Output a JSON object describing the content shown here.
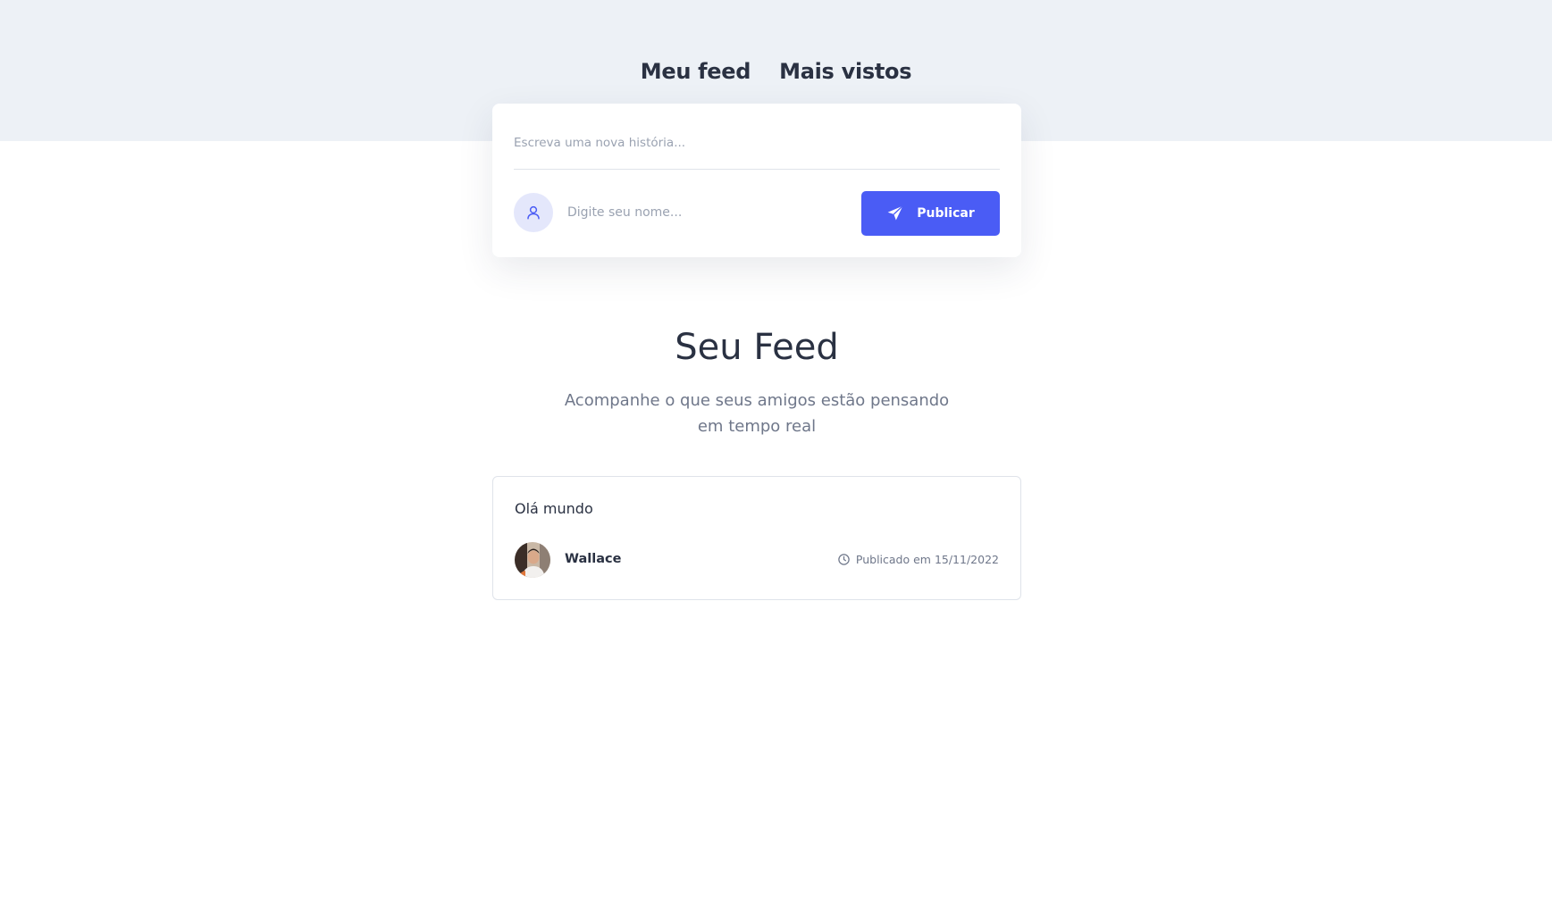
{
  "nav": {
    "tabs": [
      {
        "label": "Meu feed"
      },
      {
        "label": "Mais vistos"
      }
    ]
  },
  "composer": {
    "story_placeholder": "Escreva uma nova história...",
    "name_placeholder": "Digite seu nome...",
    "publish_label": "Publicar",
    "avatar_icon": "user-icon",
    "publish_icon": "paper-plane-icon"
  },
  "feed": {
    "title": "Seu Feed",
    "subtitle_line1": "Acompanhe o que seus amigos estão pensando",
    "subtitle_line2": "em tempo real"
  },
  "posts": [
    {
      "text": "Olá mundo",
      "author": "Wallace",
      "published": "Publicado em 15/11/2022",
      "meta_icon": "clock-icon"
    }
  ],
  "colors": {
    "accent": "#4a5cf5",
    "header_bg": "#edf1f6",
    "text": "#2a3142",
    "muted": "#6f778a"
  }
}
